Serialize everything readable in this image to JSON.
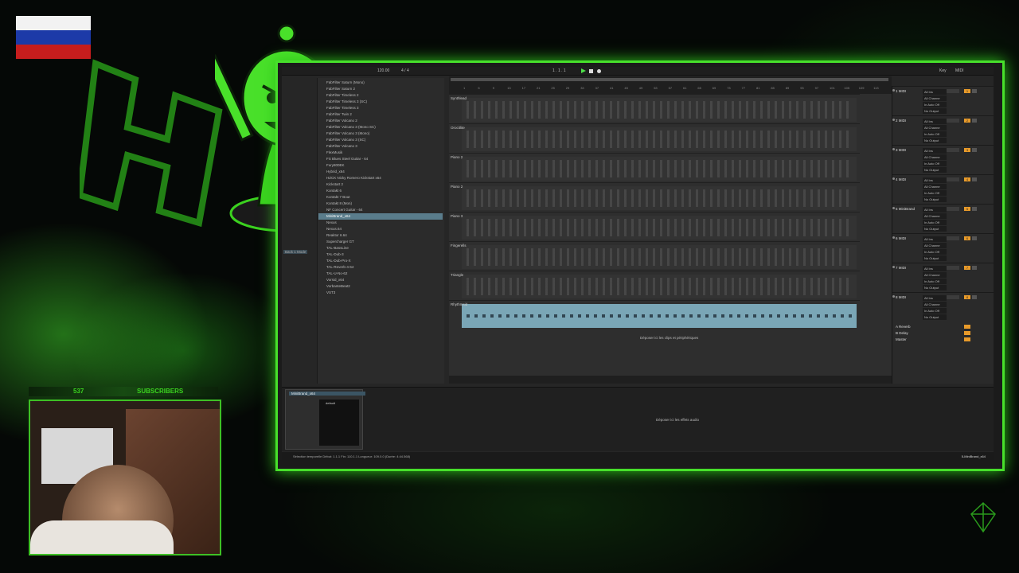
{
  "subscribers": {
    "count": "537",
    "label": "SUBSCRIBERS"
  },
  "colors": {
    "accent": "#47e02b",
    "clip_selected": "#7aa6b6",
    "record_orange": "#e79a2a"
  },
  "daw": {
    "browser_items": [
      "FabFilter Saturn (Mono)",
      "FabFilter Saturn 2",
      "FabFilter Timeless 2",
      "FabFilter Timeless 3 (SC)",
      "FabFilter Timeless 3",
      "FabFilter Twin 2",
      "FabFilter Volcano 2",
      "FabFilter Volcano 3 (Mono SC)",
      "FabFilter Volcano 3 (Mono)",
      "FabFilter Volcano 3 (SC)",
      "FabFilter Volcano 3",
      "FlexMusik",
      "FS Blues Steel Guitar - 64",
      "Fury800EK",
      "Hybrid_x64",
      "HZCK Nicky Romero Kickstart x64",
      "Kickstart 2",
      "Kontakt 6",
      "Kontakt 7 Bout",
      "Kontakt 8 (Mon)",
      "NF Concert Guitar - 64",
      "MiniBrand_x64",
      "Nexus",
      "Nexus.64",
      "Reaktor 6.64",
      "Supercharger GT",
      "TAL-BassLine",
      "TAL-Dub-3",
      "TAL-Dub-Pro-X",
      "TAL-Reverb-4-64",
      "TAL-U-No-62",
      "Vorsid_x64",
      "VorbanteBeat2",
      "VST3"
    ],
    "browser_selected_index": 21,
    "browser_left_label": "Back 1 Mode",
    "ruler_numbers": [
      "1",
      "5",
      "9",
      "13",
      "17",
      "21",
      "25",
      "29",
      "33",
      "37",
      "41",
      "45",
      "49",
      "53",
      "57",
      "61",
      "65",
      "69",
      "73",
      "77",
      "81",
      "85",
      "89",
      "93",
      "97",
      "101",
      "105",
      "109",
      "113"
    ],
    "tracks": [
      {
        "name": "Synthlead",
        "highlight": false
      },
      {
        "name": "Orocitlite",
        "highlight": false
      },
      {
        "name": "Piano 2",
        "highlight": false
      },
      {
        "name": "Piano 2",
        "highlight": false
      },
      {
        "name": "Piano 3",
        "highlight": false
      },
      {
        "name": "Fingerells",
        "highlight": false
      },
      {
        "name": "Triangle",
        "highlight": false
      },
      {
        "name": "Rhythmsid",
        "highlight": true
      }
    ],
    "drop_clips": "Déposer ici les clips et périphériques",
    "mixer_rows": [
      {
        "name": "1 MIDI",
        "num": "1"
      },
      {
        "name": "2 MIDI",
        "num": "2"
      },
      {
        "name": "3 MIDI",
        "num": "3"
      },
      {
        "name": "4 MIDI",
        "num": "4"
      },
      {
        "name": "5 MiniBrand",
        "num": "5"
      },
      {
        "name": "6 MIDI",
        "num": "6"
      },
      {
        "name": "7 MIDI",
        "num": "7"
      },
      {
        "name": "8 MIDI",
        "num": "8"
      }
    ],
    "mixer_io": [
      "All Ins",
      "All Channe",
      "In Auto Off",
      "No Output"
    ],
    "returns": [
      "A Reverb",
      "B Delay",
      "Master"
    ],
    "device_title": "MiniBrand_x64",
    "device_preset": "default",
    "drop_effects": "Déposer ici les effets audio",
    "status_left": "Sélection temporelle   Début: 1.1.1   Fin: 110.1.1   Longueur: 109.0.0 (Durée: 4:44.568)",
    "status_right": "5-MiniBrand_x64",
    "tempo": "120.00",
    "time_sig": "4 / 4",
    "position": "1 . 1 . 1",
    "key_label": "Key",
    "midi_label": "MIDI"
  }
}
